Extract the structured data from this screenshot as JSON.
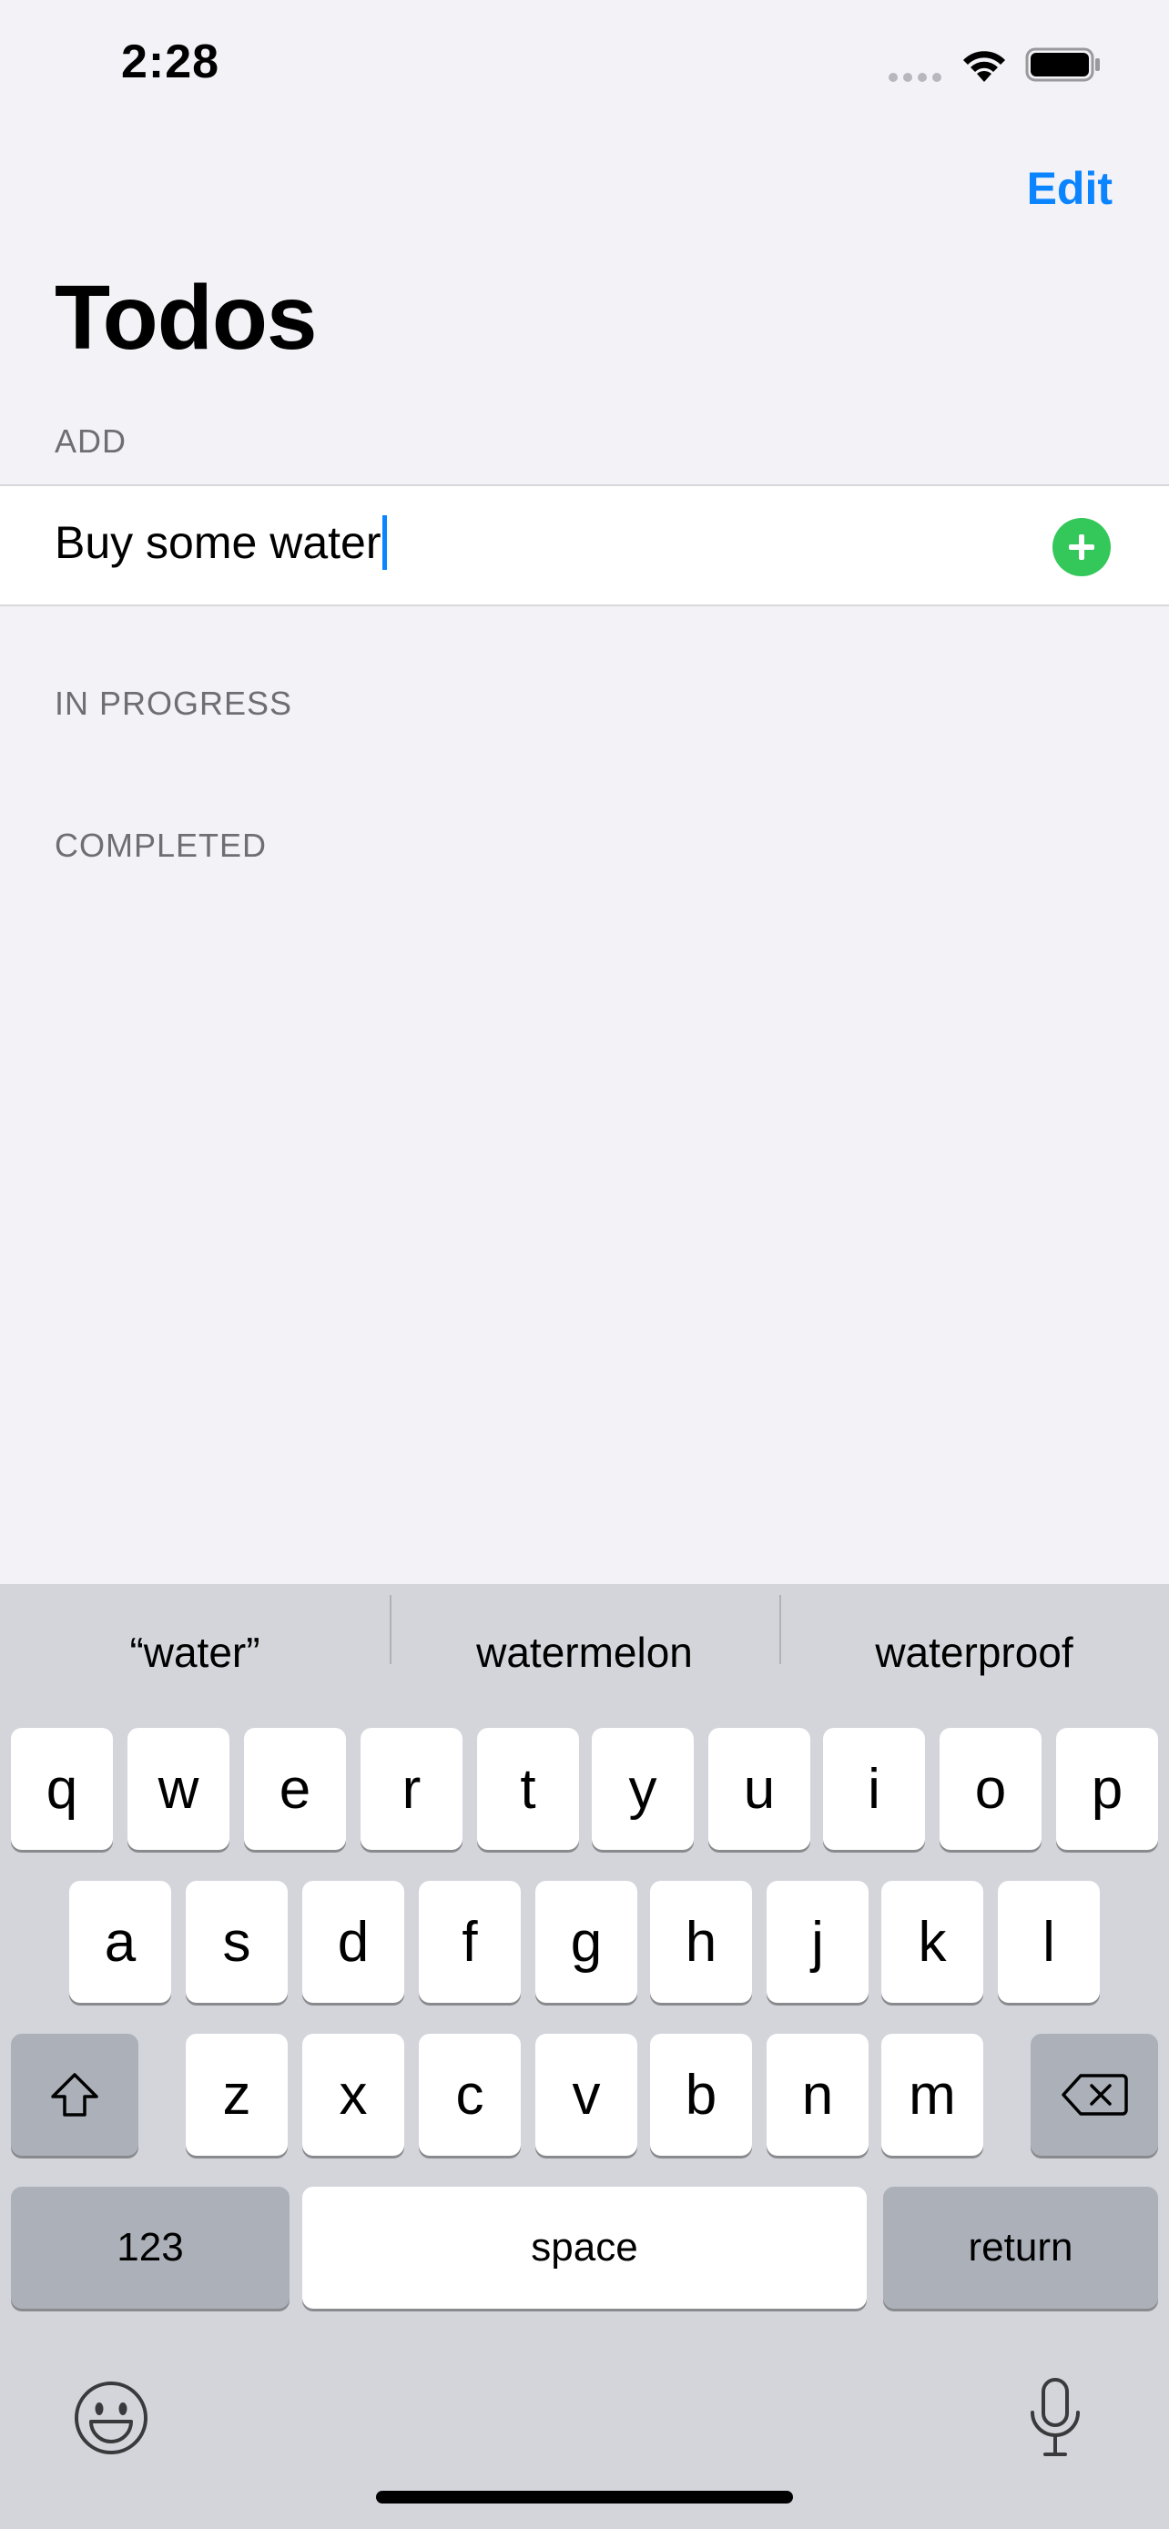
{
  "status_bar": {
    "time": "2:28"
  },
  "nav": {
    "edit_label": "Edit",
    "title": "Todos"
  },
  "sections": {
    "add": "ADD",
    "in_progress": "IN PROGRESS",
    "completed": "COMPLETED"
  },
  "add_field": {
    "value": "Buy some water"
  },
  "keyboard": {
    "suggestions": [
      "“water”",
      "watermelon",
      "waterproof"
    ],
    "row1": [
      "q",
      "w",
      "e",
      "r",
      "t",
      "y",
      "u",
      "i",
      "o",
      "p"
    ],
    "row2": [
      "a",
      "s",
      "d",
      "f",
      "g",
      "h",
      "j",
      "k",
      "l"
    ],
    "row3": [
      "z",
      "x",
      "c",
      "v",
      "b",
      "n",
      "m"
    ],
    "numbers_label": "123",
    "space_label": "space",
    "return_label": "return"
  },
  "colors": {
    "accent": "#0a84ff",
    "add_button": "#34c759",
    "background": "#f2f2f7"
  }
}
